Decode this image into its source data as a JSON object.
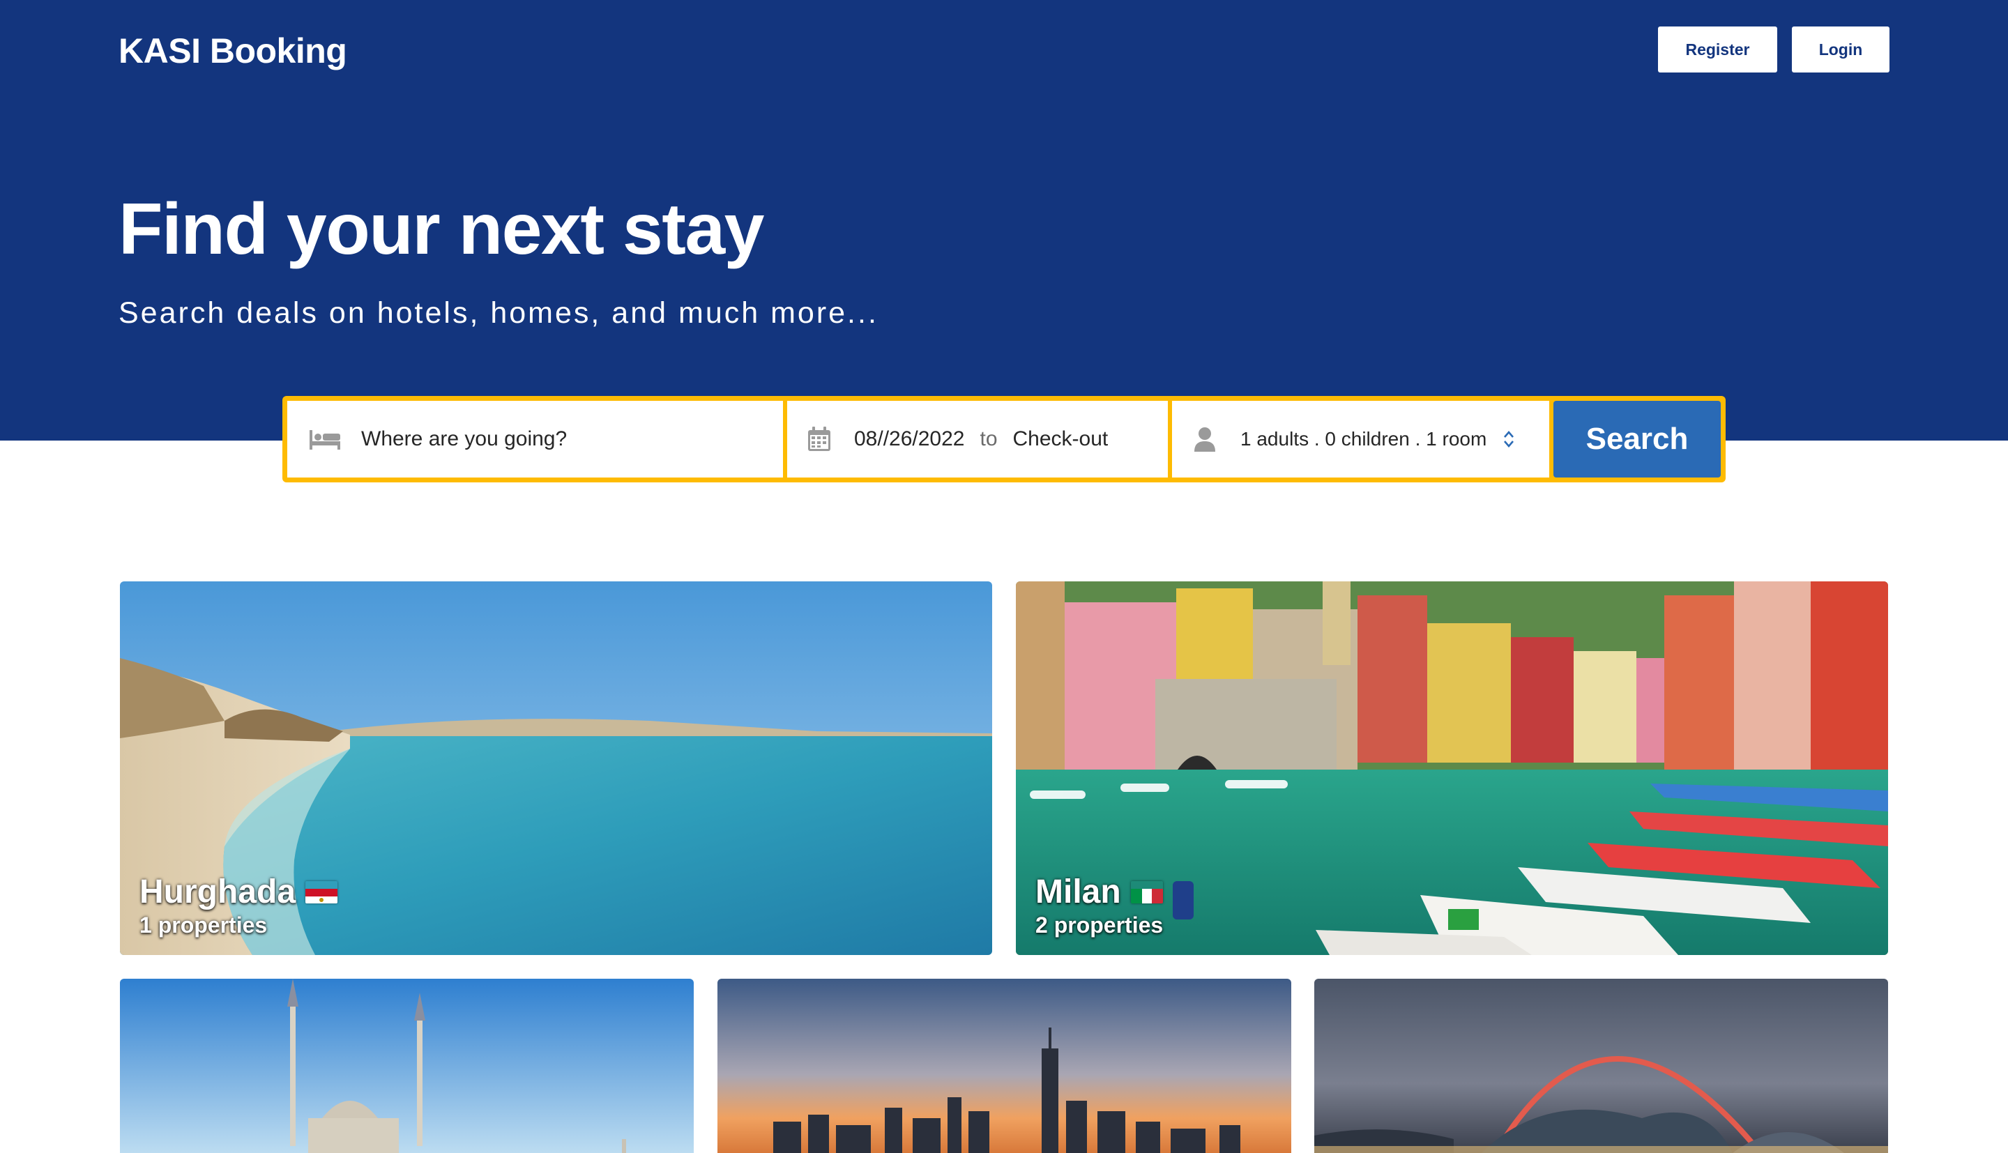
{
  "header": {
    "brand": "KASI Booking",
    "register_label": "Register",
    "login_label": "Login"
  },
  "hero": {
    "title": "Find your next stay",
    "subtitle": "Search deals on hotels, homes, and much more..."
  },
  "search": {
    "destination_placeholder": "Where are you going?",
    "checkin": "08//26/2022",
    "to_label": "to",
    "checkout": "Check-out",
    "guests": "1 adults . 0 children . 1 room",
    "button_label": "Search",
    "icons": [
      "bed-icon",
      "calendar-icon",
      "person-icon",
      "updown-chevron-icon"
    ]
  },
  "featured": [
    {
      "name": "Hurghada",
      "count": "1 properties",
      "flag": "egypt-flag"
    },
    {
      "name": "Milan",
      "count": "2 properties",
      "flag": "italy-flag"
    }
  ],
  "colors": {
    "hero_bg": "#13357e",
    "search_border": "#febb02",
    "search_button": "#2a6ab5"
  }
}
